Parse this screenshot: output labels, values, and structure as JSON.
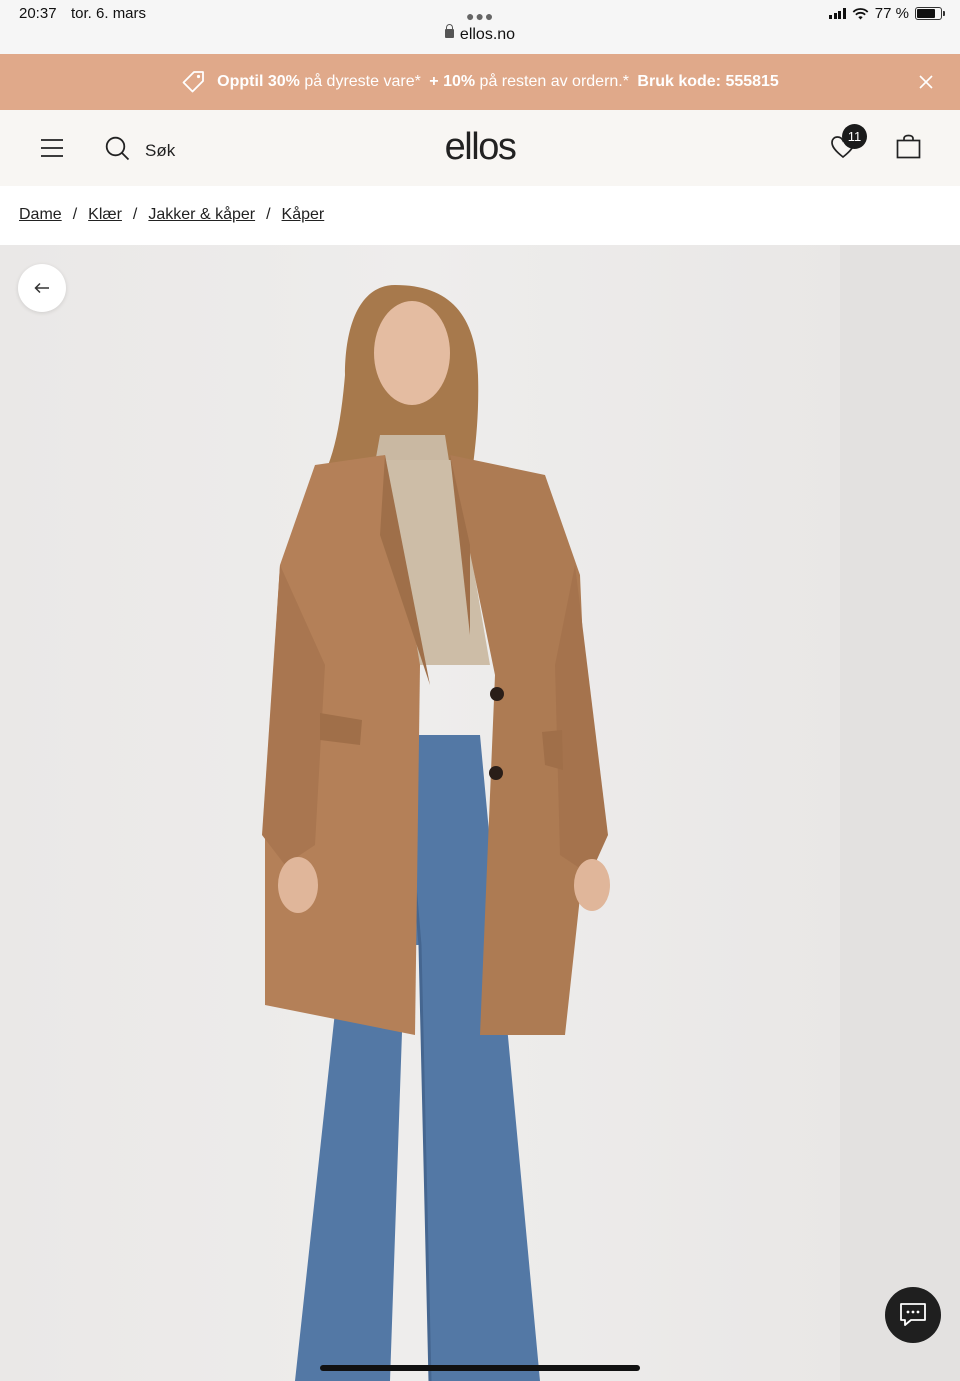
{
  "status_bar": {
    "time": "20:37",
    "date": "tor. 6. mars",
    "url": "ellos.no",
    "battery": "77 %",
    "battery_level": 0.77
  },
  "promo": {
    "part1_bold": "Opptil 30%",
    "part1_rest": "på dyreste vare*",
    "part2_bold": "+ 10%",
    "part2_rest": "på resten av ordern.*",
    "part3_bold": "Bruk kode: 555815",
    "close_icon": "close-icon",
    "background": "#e0a98a"
  },
  "header": {
    "search_label": "Søk",
    "logo": "ellos",
    "wishlist_count": "11",
    "background": "#f8f6f3"
  },
  "breadcrumb": {
    "items": [
      "Dame",
      "Klær",
      "Jakker & kåper",
      "Kåper"
    ],
    "separator": "/"
  },
  "gallery": {
    "back_icon": "arrow-left-icon",
    "chat_icon": "chat-icon"
  }
}
